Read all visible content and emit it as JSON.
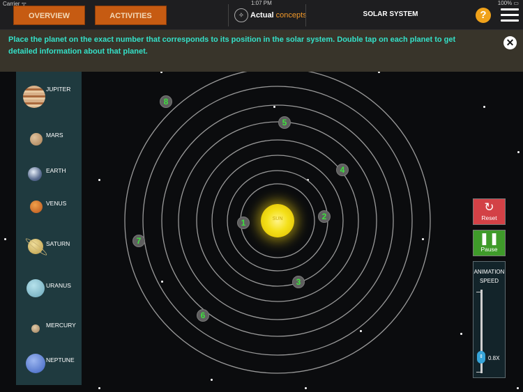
{
  "status": {
    "carrier": "Carrier ᯤ",
    "time": "1:07 PM",
    "battery": "100% ▭"
  },
  "header": {
    "tabs": [
      "OVERVIEW",
      "ACTIVITIES"
    ],
    "logo_word1": "Actual",
    "logo_word2": "concepts",
    "title": "SOLAR SYSTEM",
    "help_icon": "?"
  },
  "instruction": "Place the planet on the exact number that corresponds to its position in the solar system. Double tap on each planet to get detailed information about  that planet.",
  "planets": [
    {
      "name": "JUPITER",
      "color": "#c8935c",
      "icon": "jupiter-icon"
    },
    {
      "name": "MARS",
      "color": "#b58e63",
      "icon": "mars-icon"
    },
    {
      "name": "EARTH",
      "color": "#6c7f9a",
      "icon": "earth-icon"
    },
    {
      "name": "VENUS",
      "color": "#c8672a",
      "icon": "venus-icon"
    },
    {
      "name": "SATURN",
      "color": "#cdb66a",
      "icon": "saturn-icon"
    },
    {
      "name": "URANUS",
      "color": "#7fb4c2",
      "icon": "uranus-icon"
    },
    {
      "name": "MERCURY",
      "color": "#b89a78",
      "icon": "mercury-icon"
    },
    {
      "name": "NEPTUNE",
      "color": "#4f73c8",
      "icon": "neptune-icon"
    }
  ],
  "sun_label": "SUN",
  "markers": [
    "1",
    "2",
    "3",
    "4",
    "5",
    "6",
    "7",
    "8"
  ],
  "controls": {
    "reset_label": "Reset",
    "pause_label": "Pause",
    "speed_title": "ANIMATION SPEED",
    "speed_value": "0.8X"
  },
  "colors": {
    "tab_bg": "#c65b12",
    "instruction_text": "#34e0c8",
    "marker_text": "#3fe03f",
    "reset_bg": "#d34146",
    "pause_bg": "#3f9b2a",
    "sun": "#f4e019"
  }
}
